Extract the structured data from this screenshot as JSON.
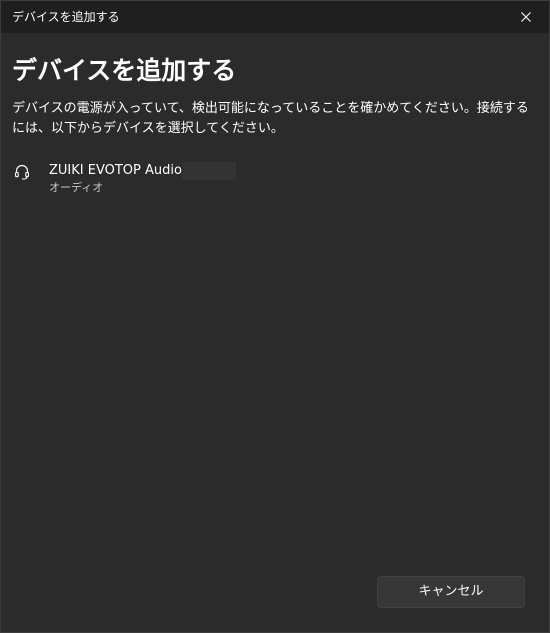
{
  "window": {
    "title": "デバイスを追加する"
  },
  "main": {
    "heading": "デバイスを追加する",
    "description": "デバイスの電源が入っていて、検出可能になっていることを確かめてください。接続するには、以下からデバイスを選択してください。"
  },
  "devices": [
    {
      "name": "ZUIKI EVOTOP Audio",
      "type": "オーディオ",
      "icon": "headset-icon"
    }
  ],
  "footer": {
    "cancel_label": "キャンセル"
  },
  "colors": {
    "titlebar_bg": "#1f1f1f",
    "content_bg": "#2b2b2b",
    "button_bg": "#373737",
    "text": "#ffffff",
    "secondary_text": "#c8c8c8"
  }
}
